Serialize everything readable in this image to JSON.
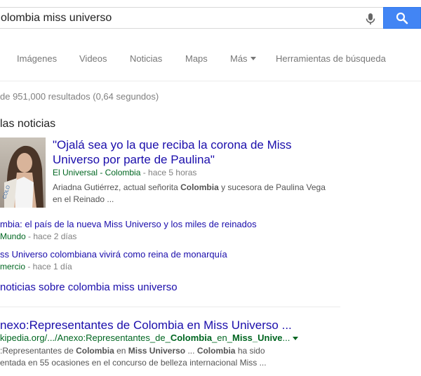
{
  "search": {
    "query": "olombia miss universo"
  },
  "tabs": [
    {
      "label": "Imágenes"
    },
    {
      "label": "Videos"
    },
    {
      "label": "Noticias"
    },
    {
      "label": "Maps"
    },
    {
      "label": "Más"
    },
    {
      "label": "Herramientas de búsqueda"
    }
  ],
  "stats": "de 951,000 resultados (0,64 segundos)",
  "news": {
    "header": "las noticias",
    "top": {
      "title": "\"Ojalá sea yo la que reciba la corona de Miss Universo por parte de Paulina\"",
      "source": "El Universal - Colombia",
      "time": " - hace 5 horas",
      "snippet_a": "Ariadna Gutiérrez, actual señorita ",
      "snippet_b": "Colombia",
      "snippet_c": " y sucesora de Paulina Vega en el Reinado ..."
    },
    "items": [
      {
        "title": "mbia: el país de la nueva Miss Universo y los miles de reinados",
        "source": "Mundo",
        "time": " - hace 2 días"
      },
      {
        "title": "ss Universo colombiana vivirá como reina de monarquía",
        "source": "mercio",
        "time": " - hace 1 día"
      }
    ],
    "more": "noticias sobre colombia miss universo"
  },
  "result": {
    "title": "nexo:Representantes de Colombia en Miss Universo ...",
    "url_a": "kipedia.org/.../Anexo:Representantes_de_",
    "url_b": "Colombia",
    "url_c": "_en_",
    "url_d": "Miss_Unive",
    "url_e": "...",
    "s1": ":Representantes de ",
    "s2": "Colombia",
    "s3": " en ",
    "s4": "Miss Universo",
    "s5": " ... ",
    "s6": "Colombia",
    "s7": " ha sido",
    "s8": "entada en 55 ocasiones en el concurso de belleza internacional Miss ..."
  },
  "colors": {
    "link": "#1a0dab",
    "source_green": "#006621",
    "search_button": "#4285f4"
  }
}
